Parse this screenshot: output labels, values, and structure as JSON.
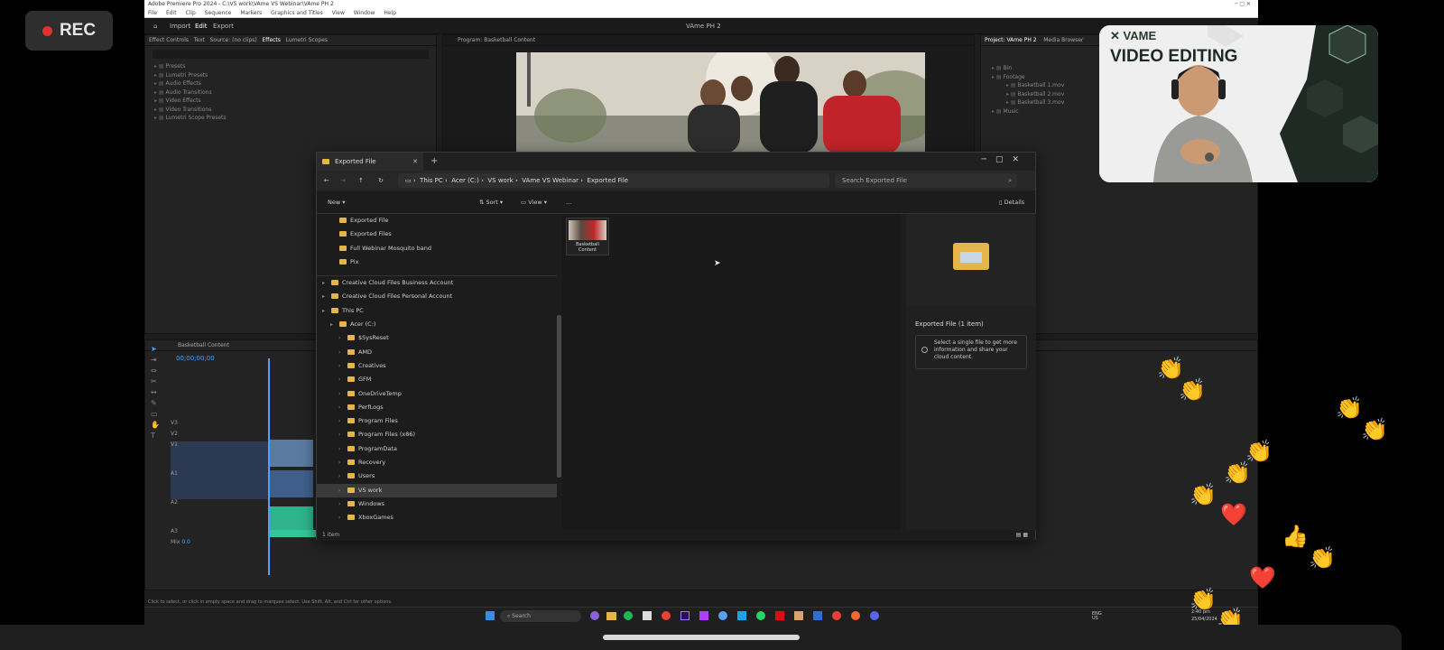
{
  "recording": {
    "label": "REC"
  },
  "premiere": {
    "title_bar": "Adobe Premiere Pro 2024 - C:\\VS work\\VAme VS Webinar\\VAme PH 2",
    "menu": [
      "File",
      "Edit",
      "Clip",
      "Sequence",
      "Markers",
      "Graphics and Titles",
      "View",
      "Window",
      "Help"
    ],
    "workspace_tabs": [
      "Import",
      "Edit",
      "Export"
    ],
    "project_name": "VAme PH 2",
    "source_panel_tabs": [
      "Effect Controls",
      "Text",
      "Source: (no clips)",
      "Effects",
      "Lumetri Scopes"
    ],
    "effects_tree": [
      "Presets",
      "Lumetri Presets",
      "Audio Effects",
      "Audio Transitions",
      "Video Effects",
      "Video Transitions",
      "Lumetri Scope Presets"
    ],
    "program_title": "Program: Basketball Content",
    "project_panel_title": "Project: VAme PH 2",
    "project_panel_tab2": "Media Browser",
    "project_bins": [
      "Bin",
      "Footage",
      "Basketball 1.mov",
      "Basketball 2.mov",
      "Basketball 3.mov",
      "Music"
    ],
    "sequence_name": "Basketball Content",
    "timecode": "00;00;00;00",
    "tracks": [
      "V3",
      "V2",
      "V1",
      "A1",
      "A2",
      "A3",
      "Mix"
    ],
    "mix_value": "0.0",
    "status_bar": "Click to select, or click in empty space and drag to marquee select. Use Shift, Alt, and Ctrl for other options."
  },
  "explorer": {
    "tab_title": "Exported File",
    "breadcrumb": [
      "This PC",
      "Acer (C:)",
      "VS work",
      "VAme VS Webinar",
      "Exported File"
    ],
    "search_placeholder": "Search Exported File",
    "cmd": {
      "new": "New",
      "sort": "Sort",
      "view": "View",
      "more": "...",
      "details": "Details"
    },
    "sidebar": [
      {
        "label": "Exported File",
        "indent": 1
      },
      {
        "label": "Exported Files",
        "indent": 1
      },
      {
        "label": "Full Webinar Mosquito band",
        "indent": 1
      },
      {
        "label": "Pix",
        "indent": 1
      },
      {
        "label": "",
        "indent": 0
      },
      {
        "label": "Creative Cloud Files Business Account",
        "indent": 0
      },
      {
        "label": "Creative Cloud Files Personal Account",
        "indent": 0
      },
      {
        "label": "This PC",
        "indent": 0
      },
      {
        "label": "Acer (C:)",
        "indent": 1
      },
      {
        "label": "$SysReset",
        "indent": 2
      },
      {
        "label": "AMD",
        "indent": 2
      },
      {
        "label": "Creatives",
        "indent": 2
      },
      {
        "label": "GFM",
        "indent": 2
      },
      {
        "label": "OneDriveTemp",
        "indent": 2
      },
      {
        "label": "PerfLogs",
        "indent": 2
      },
      {
        "label": "Program Files",
        "indent": 2
      },
      {
        "label": "Program Files (x86)",
        "indent": 2
      },
      {
        "label": "ProgramData",
        "indent": 2
      },
      {
        "label": "Recovery",
        "indent": 2
      },
      {
        "label": "Users",
        "indent": 2
      },
      {
        "label": "VS work",
        "indent": 2
      },
      {
        "label": "Windows",
        "indent": 2
      },
      {
        "label": "XboxGames",
        "indent": 2
      }
    ],
    "selected_sidebar_index": 20,
    "file": {
      "name": "Basketball Content"
    },
    "details": {
      "title": "Exported File (1 item)",
      "hint": "Select a single file to get more information and share your cloud content."
    },
    "status": "1 item"
  },
  "webcam": {
    "brand": "VAME",
    "title": "VIDEO EDITING"
  },
  "taskbar": {
    "search_placeholder": "Search",
    "lang": "ENG\nUS",
    "time": "2:40 pm",
    "date": "25/04/2024"
  },
  "reactions": [
    "👏",
    "👏",
    "👏",
    "👏",
    "👏",
    "👏",
    "👏",
    "❤️",
    "👍",
    "👏",
    "❤️",
    "👏",
    "👏"
  ]
}
